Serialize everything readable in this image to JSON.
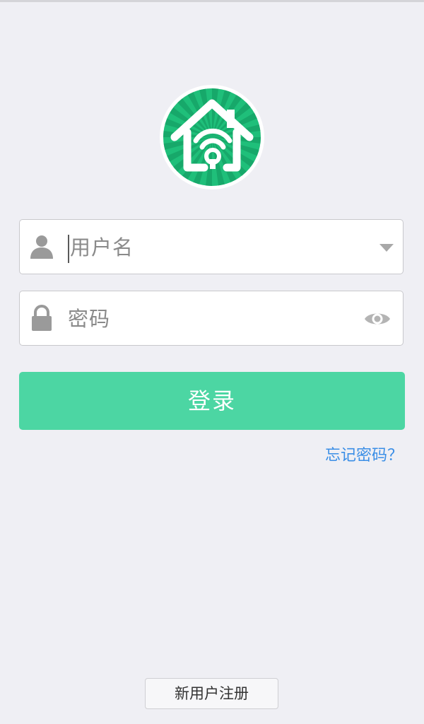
{
  "app": {
    "logo_icon": "smart-home-wifi-logo",
    "brand_color": "#1fbf7a"
  },
  "login_form": {
    "username": {
      "placeholder": "用户名",
      "icon": "user-icon",
      "trailing_icon": "dropdown-arrow-icon"
    },
    "password": {
      "placeholder": "密码",
      "icon": "lock-icon",
      "trailing_icon": "eye-icon"
    },
    "login_button": "登录",
    "forgot_password": "忘记密码？",
    "accent_color": "#4cd6a3",
    "link_color": "#3a8ee6"
  },
  "footer": {
    "register_button": "新用户注册"
  }
}
